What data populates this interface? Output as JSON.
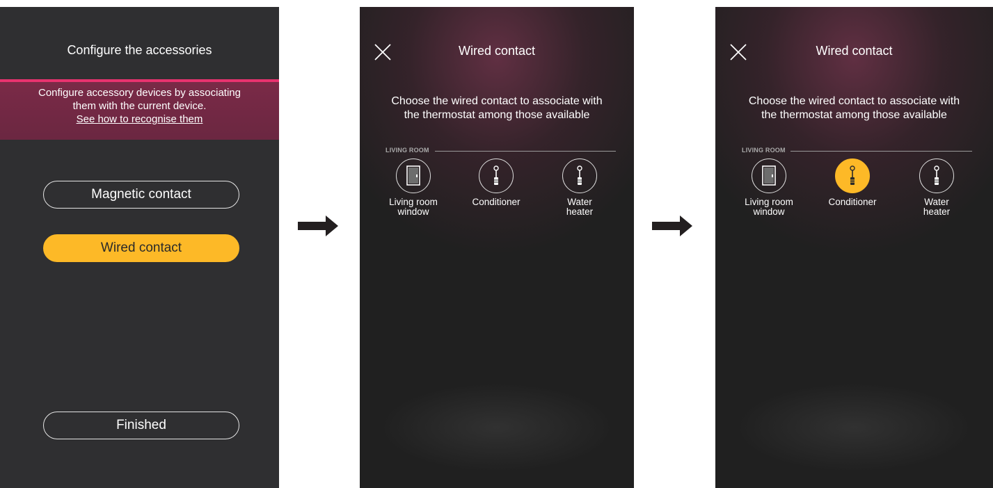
{
  "screen1": {
    "title": "Configure the accessories",
    "banner_line1": "Configure accessory devices by associating",
    "banner_line2": "them with the current device.",
    "banner_link": "See how to recognise them",
    "buttons": {
      "magnetic": "Magnetic contact",
      "wired": "Wired contact",
      "finished": "Finished"
    },
    "accent_color": "#fdb927",
    "line_color": "#e8336f"
  },
  "screen2": {
    "title": "Wired contact",
    "subtitle_line1": "Choose the wired contact to associate with",
    "subtitle_line2": "the thermostat among those available",
    "room": "LIVING ROOM",
    "items": [
      {
        "label1": "Living room",
        "label2": "window",
        "icon": "door-icon"
      },
      {
        "label1": "Conditioner",
        "label2": "",
        "icon": "sensor-probe-icon"
      },
      {
        "label1": "Water",
        "label2": "heater",
        "icon": "sensor-probe-icon"
      }
    ]
  },
  "screen3": {
    "title": "Wired contact",
    "subtitle_line1": "Choose the wired contact to associate with",
    "subtitle_line2": "the thermostat among those available",
    "room": "LIVING ROOM",
    "items": [
      {
        "label1": "Living room",
        "label2": "window",
        "icon": "door-icon",
        "selected": false
      },
      {
        "label1": "Conditioner",
        "label2": "",
        "icon": "sensor-probe-icon",
        "selected": true
      },
      {
        "label1": "Water",
        "label2": "heater",
        "icon": "sensor-probe-icon",
        "selected": false
      }
    ]
  },
  "flow_arrow_icon": "right-arrow-icon"
}
